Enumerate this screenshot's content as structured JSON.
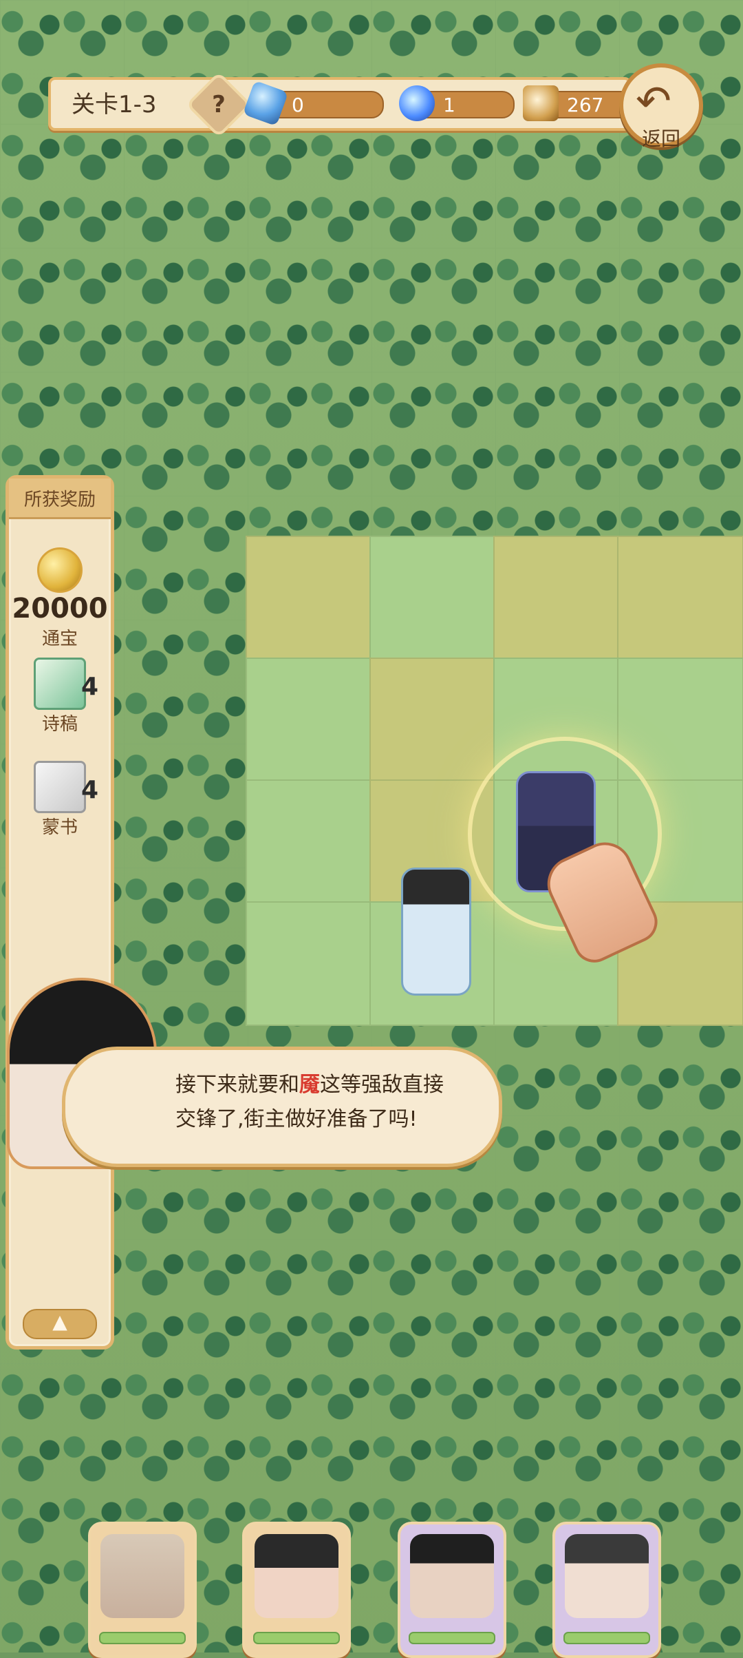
{
  "hud": {
    "level": "关卡1-3",
    "help_symbol": "?",
    "resources": {
      "crystal": {
        "icon": "crystal-icon",
        "value": "0"
      },
      "flame": {
        "icon": "flame-icon",
        "value": "1"
      },
      "cup": {
        "icon": "cup-icon",
        "value": "267"
      }
    },
    "back": {
      "icon": "back-arrow-icon",
      "label": "返回"
    }
  },
  "rewards": {
    "title": "所获奖励",
    "items": [
      {
        "value": "20000",
        "name": "通宝",
        "icon": "coin-icon"
      },
      {
        "value": "4",
        "name": "诗稿",
        "icon": "poem-scroll-icon"
      },
      {
        "value": "4",
        "name": "蒙书",
        "icon": "book-icon"
      }
    ],
    "toggle_icon": "up-arrow-icon",
    "toggle_symbol": "▲"
  },
  "dialog": {
    "text_before": "接下来就要和",
    "highlight": "魇",
    "text_after_line1": "这等强敌直接",
    "line2": "交锋了,街主做好准备了吗!"
  },
  "board": {
    "rows": 4,
    "cols": 4
  },
  "characters": {
    "hero": "hero-character",
    "enemy": "hooded-enemy",
    "pointer": "hand-pointer-icon"
  },
  "team_cards": [
    {
      "name": "team-card-1"
    },
    {
      "name": "team-card-2"
    },
    {
      "name": "team-card-3"
    },
    {
      "name": "team-card-4"
    }
  ],
  "colors": {
    "accent": "#e0b56f",
    "highlight_text": "#d83b2f",
    "tile_green": "#a9d08c",
    "tile_dry": "#c6c87b"
  }
}
